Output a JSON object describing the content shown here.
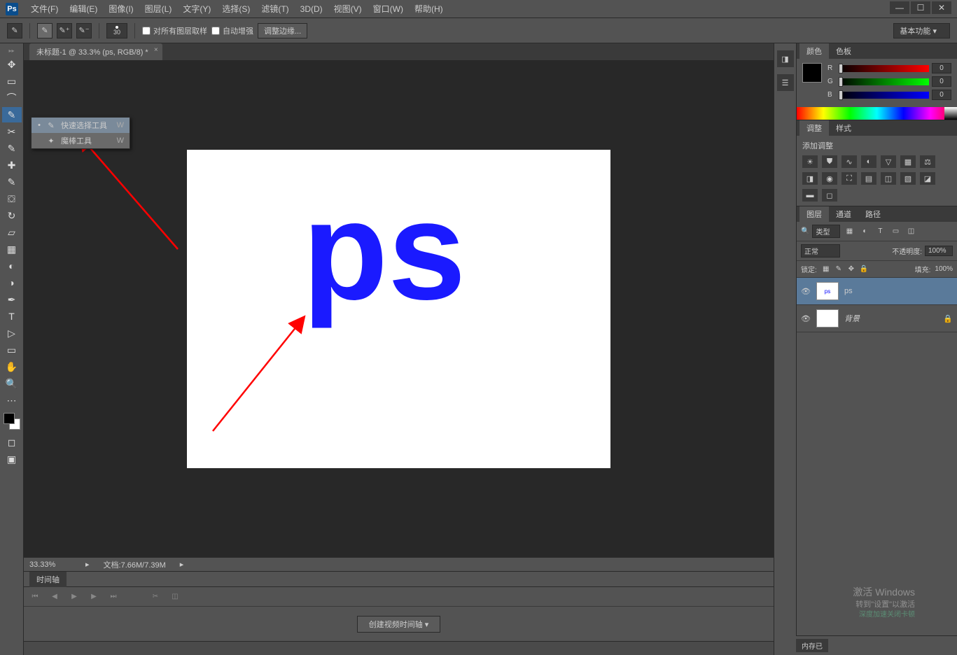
{
  "menubar": {
    "items": [
      "文件(F)",
      "编辑(E)",
      "图像(I)",
      "图层(L)",
      "文字(Y)",
      "选择(S)",
      "滤镜(T)",
      "3D(D)",
      "视图(V)",
      "窗口(W)",
      "帮助(H)"
    ]
  },
  "optionsbar": {
    "brush_size": "30",
    "sample_all_layers": "对所有图层取样",
    "auto_enhance": "自动增强",
    "refine_edge": "调整边缘...",
    "workspace": "基本功能"
  },
  "document": {
    "tab_title": "未标题-1 @ 33.3% (ps, RGB/8) *",
    "canvas_text": "ps",
    "zoom": "33.33%",
    "doc_info": "文档:7.66M/7.39M"
  },
  "tool_flyout": {
    "items": [
      {
        "label": "快速选择工具",
        "key": "W",
        "selected": true
      },
      {
        "label": "魔棒工具",
        "key": "W",
        "selected": false
      }
    ]
  },
  "timeline": {
    "tab": "时间轴",
    "create_btn": "创建视频时间轴"
  },
  "panels": {
    "color": {
      "tabs": [
        "颜色",
        "色板"
      ],
      "r": "0",
      "g": "0",
      "b": "0"
    },
    "adjustments": {
      "tabs": [
        "调整",
        "样式"
      ],
      "label": "添加调整"
    },
    "layers": {
      "tabs": [
        "图层",
        "通道",
        "路径"
      ],
      "filter_kind": "类型",
      "blend_mode": "正常",
      "opacity_label": "不透明度:",
      "opacity_value": "100%",
      "lock_label": "锁定:",
      "fill_label": "填充:",
      "fill_value": "100%",
      "items": [
        {
          "name": "ps",
          "selected": true,
          "locked": false
        },
        {
          "name": "背景",
          "selected": false,
          "locked": true
        }
      ]
    }
  },
  "status": {
    "memory": "内存已",
    "watermark_line1": "激活 Windows",
    "watermark_line2": "转到\"设置\"以激活",
    "watermark_line3": "深度加速关闭卡顿"
  }
}
